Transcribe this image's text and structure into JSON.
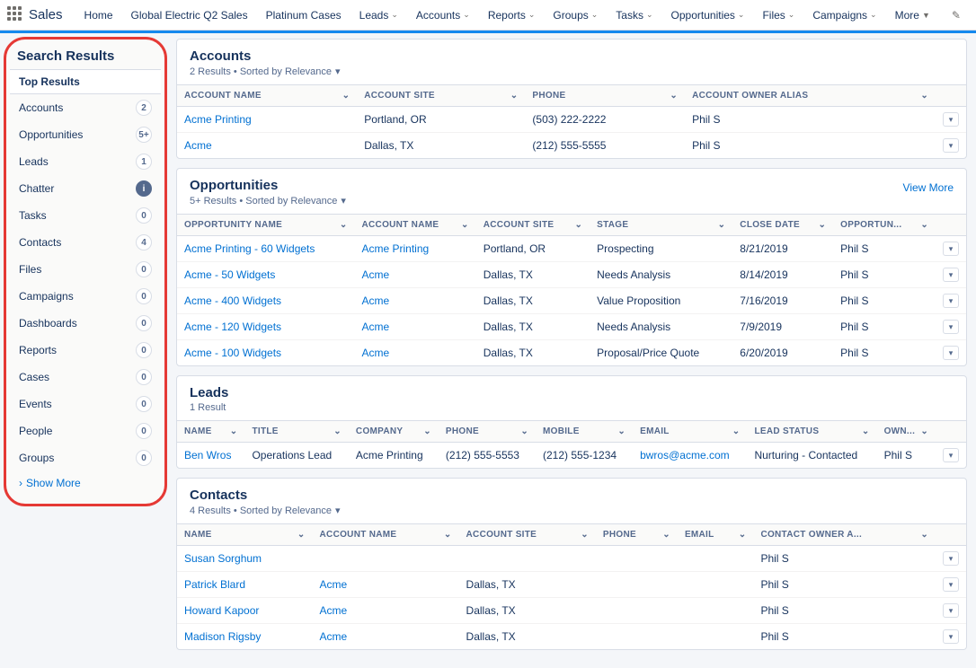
{
  "topnav": {
    "app": "Sales",
    "items": [
      "Home",
      "Global Electric Q2 Sales",
      "Platinum Cases",
      "Leads",
      "Accounts",
      "Reports",
      "Groups",
      "Tasks",
      "Opportunities",
      "Files",
      "Campaigns",
      "More"
    ],
    "dropdown_after_index": 2
  },
  "sidebar": {
    "title": "Search Results",
    "active": "Top Results",
    "items": [
      {
        "label": "Top Results",
        "badge": null
      },
      {
        "label": "Accounts",
        "badge": "2"
      },
      {
        "label": "Opportunities",
        "badge": "5+"
      },
      {
        "label": "Leads",
        "badge": "1"
      },
      {
        "label": "Chatter",
        "badge": "info"
      },
      {
        "label": "Tasks",
        "badge": "0"
      },
      {
        "label": "Contacts",
        "badge": "4"
      },
      {
        "label": "Files",
        "badge": "0"
      },
      {
        "label": "Campaigns",
        "badge": "0"
      },
      {
        "label": "Dashboards",
        "badge": "0"
      },
      {
        "label": "Reports",
        "badge": "0"
      },
      {
        "label": "Cases",
        "badge": "0"
      },
      {
        "label": "Events",
        "badge": "0"
      },
      {
        "label": "People",
        "badge": "0"
      },
      {
        "label": "Groups",
        "badge": "0"
      }
    ],
    "show_more": "Show More"
  },
  "sections": {
    "accounts": {
      "title": "Accounts",
      "sub": "2 Results • Sorted by Relevance",
      "cols": [
        "ACCOUNT NAME",
        "ACCOUNT SITE",
        "PHONE",
        "ACCOUNT OWNER ALIAS"
      ],
      "rows": [
        {
          "name": "Acme Printing",
          "site": "Portland, OR",
          "phone": "(503) 222-2222",
          "owner": "Phil S"
        },
        {
          "name": "Acme",
          "site": "Dallas, TX",
          "phone": "(212) 555-5555",
          "owner": "Phil S"
        }
      ]
    },
    "opportunities": {
      "title": "Opportunities",
      "sub": "5+ Results • Sorted by Relevance",
      "view_more": "View More",
      "cols": [
        "OPPORTUNITY NAME",
        "ACCOUNT NAME",
        "ACCOUNT SITE",
        "STAGE",
        "CLOSE DATE",
        "OPPORTUN..."
      ],
      "rows": [
        {
          "name": "Acme Printing - 60 Widgets",
          "account": "Acme Printing",
          "site": "Portland, OR",
          "stage": "Prospecting",
          "close": "8/21/2019",
          "owner": "Phil S"
        },
        {
          "name": "Acme - 50 Widgets",
          "account": "Acme",
          "site": "Dallas, TX",
          "stage": "Needs Analysis",
          "close": "8/14/2019",
          "owner": "Phil S"
        },
        {
          "name": "Acme - 400 Widgets",
          "account": "Acme",
          "site": "Dallas, TX",
          "stage": "Value Proposition",
          "close": "7/16/2019",
          "owner": "Phil S"
        },
        {
          "name": "Acme - 120 Widgets",
          "account": "Acme",
          "site": "Dallas, TX",
          "stage": "Needs Analysis",
          "close": "7/9/2019",
          "owner": "Phil S"
        },
        {
          "name": "Acme - 100 Widgets",
          "account": "Acme",
          "site": "Dallas, TX",
          "stage": "Proposal/Price Quote",
          "close": "6/20/2019",
          "owner": "Phil S"
        }
      ]
    },
    "leads": {
      "title": "Leads",
      "sub": "1 Result",
      "cols": [
        "NAME",
        "TITLE",
        "COMPANY",
        "PHONE",
        "MOBILE",
        "EMAIL",
        "LEAD STATUS",
        "OWN..."
      ],
      "rows": [
        {
          "name": "Ben Wros",
          "title": "Operations Lead",
          "company": "Acme Printing",
          "phone": "(212) 555-5553",
          "mobile": "(212) 555-1234",
          "email": "bwros@acme.com",
          "status": "Nurturing - Contacted",
          "owner": "Phil S"
        }
      ]
    },
    "contacts": {
      "title": "Contacts",
      "sub": "4 Results • Sorted by Relevance",
      "cols": [
        "NAME",
        "ACCOUNT NAME",
        "ACCOUNT SITE",
        "PHONE",
        "EMAIL",
        "CONTACT OWNER A..."
      ],
      "rows": [
        {
          "name": "Susan Sorghum",
          "account": "",
          "site": "",
          "phone": "",
          "email": "",
          "owner": "Phil S"
        },
        {
          "name": "Patrick Blard",
          "account": "Acme",
          "site": "Dallas, TX",
          "phone": "",
          "email": "",
          "owner": "Phil S"
        },
        {
          "name": "Howard Kapoor",
          "account": "Acme",
          "site": "Dallas, TX",
          "phone": "",
          "email": "",
          "owner": "Phil S"
        },
        {
          "name": "Madison Rigsby",
          "account": "Acme",
          "site": "Dallas, TX",
          "phone": "",
          "email": "",
          "owner": "Phil S"
        }
      ]
    }
  }
}
